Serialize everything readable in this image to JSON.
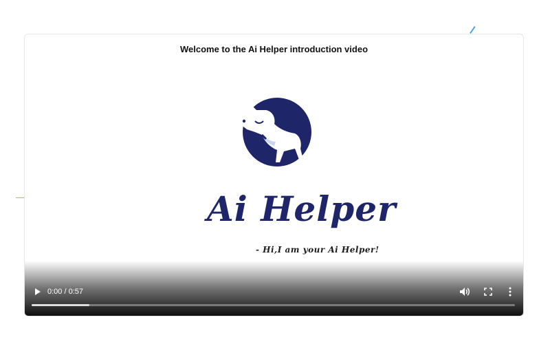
{
  "video": {
    "title": "Welcome to the Ai Helper introduction video",
    "brand_name": "Ai Helper",
    "tagline": "- Hi,I am your Ai Helper!",
    "brand_color": "#1e2569"
  },
  "controls": {
    "time_display": "0:00 / 0:57",
    "play_icon": "play-icon",
    "volume_icon": "volume-icon",
    "fullscreen_icon": "fullscreen-icon",
    "more_icon": "more-options-icon",
    "buffered_fraction": 0.12
  }
}
